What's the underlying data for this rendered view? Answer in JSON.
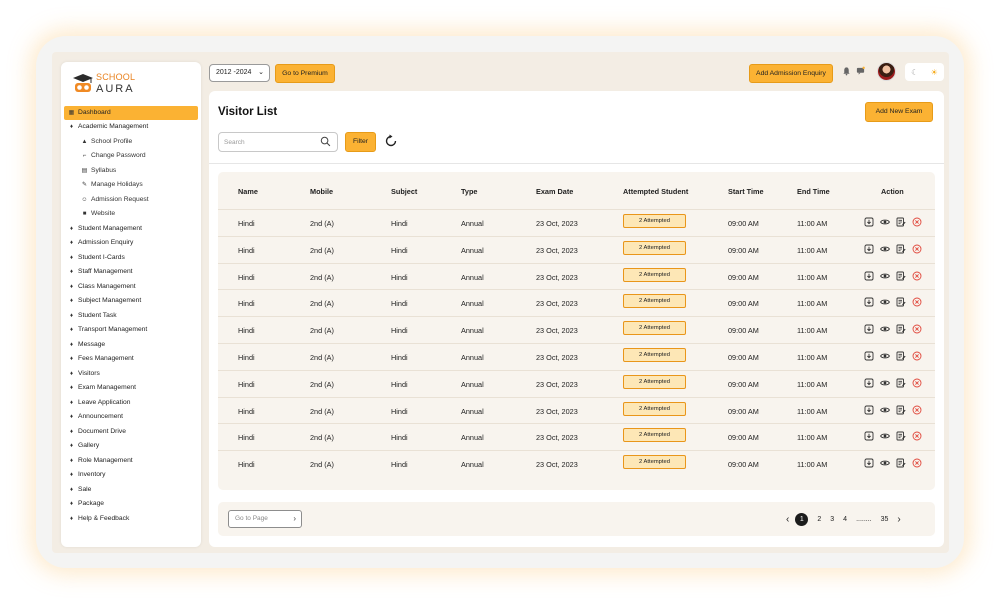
{
  "brand": {
    "line1": "SCHOOL",
    "line2": "AURA"
  },
  "colors": {
    "accent": "#fbb233",
    "accent_border": "#e79b18",
    "badge_bg": "#fde7b6",
    "delete": "#e0473b"
  },
  "sidebar": {
    "items": [
      {
        "label": "Dashboard",
        "active": true,
        "sub": false,
        "icon": "grid-icon"
      },
      {
        "label": "Academic Management",
        "sub": false,
        "icon": "graduation-cap-icon"
      },
      {
        "label": "School Profile",
        "sub": true,
        "icon": "school-icon"
      },
      {
        "label": "Change Password",
        "sub": true,
        "icon": "key-icon"
      },
      {
        "label": "Syllabus",
        "sub": true,
        "icon": "book-icon"
      },
      {
        "label": "Manage Holidays",
        "sub": true,
        "icon": "pencil-icon"
      },
      {
        "label": "Admission Request",
        "sub": true,
        "icon": "users-icon"
      },
      {
        "label": "Website",
        "sub": true,
        "icon": "globe-icon"
      },
      {
        "label": "Student Management",
        "sub": false,
        "icon": "graduation-cap-icon"
      },
      {
        "label": "Admission Enquiry",
        "sub": false,
        "icon": "graduation-cap-icon"
      },
      {
        "label": "Student I-Cards",
        "sub": false,
        "icon": "graduation-cap-icon"
      },
      {
        "label": "Staff Management",
        "sub": false,
        "icon": "graduation-cap-icon"
      },
      {
        "label": "Class Management",
        "sub": false,
        "icon": "graduation-cap-icon"
      },
      {
        "label": "Subject Management",
        "sub": false,
        "icon": "graduation-cap-icon"
      },
      {
        "label": "Student Task",
        "sub": false,
        "icon": "graduation-cap-icon"
      },
      {
        "label": "Transport Management",
        "sub": false,
        "icon": "graduation-cap-icon"
      },
      {
        "label": "Message",
        "sub": false,
        "icon": "graduation-cap-icon"
      },
      {
        "label": "Fees Management",
        "sub": false,
        "icon": "graduation-cap-icon"
      },
      {
        "label": "Visitors",
        "sub": false,
        "icon": "graduation-cap-icon"
      },
      {
        "label": "Exam Management",
        "sub": false,
        "icon": "graduation-cap-icon"
      },
      {
        "label": "Leave Application",
        "sub": false,
        "icon": "graduation-cap-icon"
      },
      {
        "label": "Announcement",
        "sub": false,
        "icon": "graduation-cap-icon"
      },
      {
        "label": "Document Drive",
        "sub": false,
        "icon": "graduation-cap-icon"
      },
      {
        "label": "Gallery",
        "sub": false,
        "icon": "graduation-cap-icon"
      },
      {
        "label": "Role Management",
        "sub": false,
        "icon": "graduation-cap-icon"
      },
      {
        "label": "Inventory",
        "sub": false,
        "icon": "graduation-cap-icon"
      },
      {
        "label": "Sale",
        "sub": false,
        "icon": "graduation-cap-icon"
      },
      {
        "label": "Package",
        "sub": false,
        "icon": "graduation-cap-icon"
      },
      {
        "label": "Help & Feedback",
        "sub": false,
        "icon": "graduation-cap-icon"
      }
    ]
  },
  "topbar": {
    "year": "2012 -2024",
    "premium_label": "Go to Premium",
    "enquiry_label": "Add Admission Enquiry"
  },
  "page": {
    "title": "Visitor List",
    "add_label": "Add New Exam",
    "search_placeholder": "Search",
    "filter_label": "Filter"
  },
  "table": {
    "columns": [
      "Name",
      "Mobile",
      "Subject",
      "Type",
      "Exam Date",
      "Attempted Student",
      "Start Time",
      "End Time",
      "Action"
    ],
    "rows": [
      {
        "name": "Hindi",
        "mobile": "2nd (A)",
        "subject": "Hindi",
        "type": "Annual",
        "exam_date": "23 Oct, 2023",
        "attempted": "2 Attempted",
        "start": "09:00 AM",
        "end": "11:00 AM"
      },
      {
        "name": "Hindi",
        "mobile": "2nd (A)",
        "subject": "Hindi",
        "type": "Annual",
        "exam_date": "23 Oct, 2023",
        "attempted": "2 Attempted",
        "start": "09:00 AM",
        "end": "11:00 AM"
      },
      {
        "name": "Hindi",
        "mobile": "2nd (A)",
        "subject": "Hindi",
        "type": "Annual",
        "exam_date": "23 Oct, 2023",
        "attempted": "2 Attempted",
        "start": "09:00 AM",
        "end": "11:00 AM"
      },
      {
        "name": "Hindi",
        "mobile": "2nd (A)",
        "subject": "Hindi",
        "type": "Annual",
        "exam_date": "23 Oct, 2023",
        "attempted": "2 Attempted",
        "start": "09:00 AM",
        "end": "11:00 AM"
      },
      {
        "name": "Hindi",
        "mobile": "2nd (A)",
        "subject": "Hindi",
        "type": "Annual",
        "exam_date": "23 Oct, 2023",
        "attempted": "2 Attempted",
        "start": "09:00 AM",
        "end": "11:00 AM"
      },
      {
        "name": "Hindi",
        "mobile": "2nd (A)",
        "subject": "Hindi",
        "type": "Annual",
        "exam_date": "23 Oct, 2023",
        "attempted": "2 Attempted",
        "start": "09:00 AM",
        "end": "11:00 AM"
      },
      {
        "name": "Hindi",
        "mobile": "2nd (A)",
        "subject": "Hindi",
        "type": "Annual",
        "exam_date": "23 Oct, 2023",
        "attempted": "2 Attempted",
        "start": "09:00 AM",
        "end": "11:00 AM"
      },
      {
        "name": "Hindi",
        "mobile": "2nd (A)",
        "subject": "Hindi",
        "type": "Annual",
        "exam_date": "23 Oct, 2023",
        "attempted": "2 Attempted",
        "start": "09:00 AM",
        "end": "11:00 AM"
      },
      {
        "name": "Hindi",
        "mobile": "2nd (A)",
        "subject": "Hindi",
        "type": "Annual",
        "exam_date": "23 Oct, 2023",
        "attempted": "2 Attempted",
        "start": "09:00 AM",
        "end": "11:00 AM"
      },
      {
        "name": "Hindi",
        "mobile": "2nd (A)",
        "subject": "Hindi",
        "type": "Annual",
        "exam_date": "23 Oct, 2023",
        "attempted": "2 Attempted",
        "start": "09:00 AM",
        "end": "11:00 AM"
      }
    ],
    "action_icons": [
      "download-icon",
      "eye-icon",
      "edit-icon",
      "delete-icon"
    ]
  },
  "pagination": {
    "goto_placeholder": "Go to Page",
    "pages": [
      "1",
      "2",
      "3",
      "4",
      "........",
      "35"
    ],
    "current": "1"
  }
}
